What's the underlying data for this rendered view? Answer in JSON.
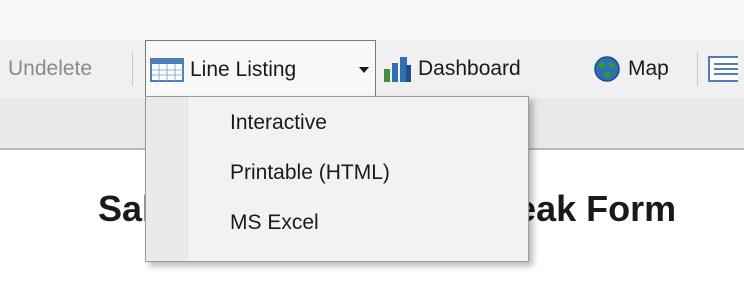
{
  "toolbar": {
    "undelete_label": "Undelete",
    "line_listing_label": "Line Listing",
    "dashboard_label": "Dashboard",
    "map_label": "Map"
  },
  "dropdown": {
    "items": [
      {
        "label": "Interactive"
      },
      {
        "label": "Printable (HTML)"
      },
      {
        "label": "MS Excel"
      }
    ]
  },
  "page": {
    "heading_left": "Sal",
    "heading_right": "eak Form"
  },
  "icons": {
    "line_listing": "table-grid-icon",
    "dashboard": "bar-chart-icon",
    "map": "globe-icon",
    "partial": "list-icon"
  },
  "colors": {
    "toolbar_bg": "#f0f0f0",
    "menu_bg": "#f2f2f2",
    "disabled_text": "#8a8a8a",
    "chart_blue": "#2f6fb3",
    "globe_green": "#2e9a3a"
  }
}
